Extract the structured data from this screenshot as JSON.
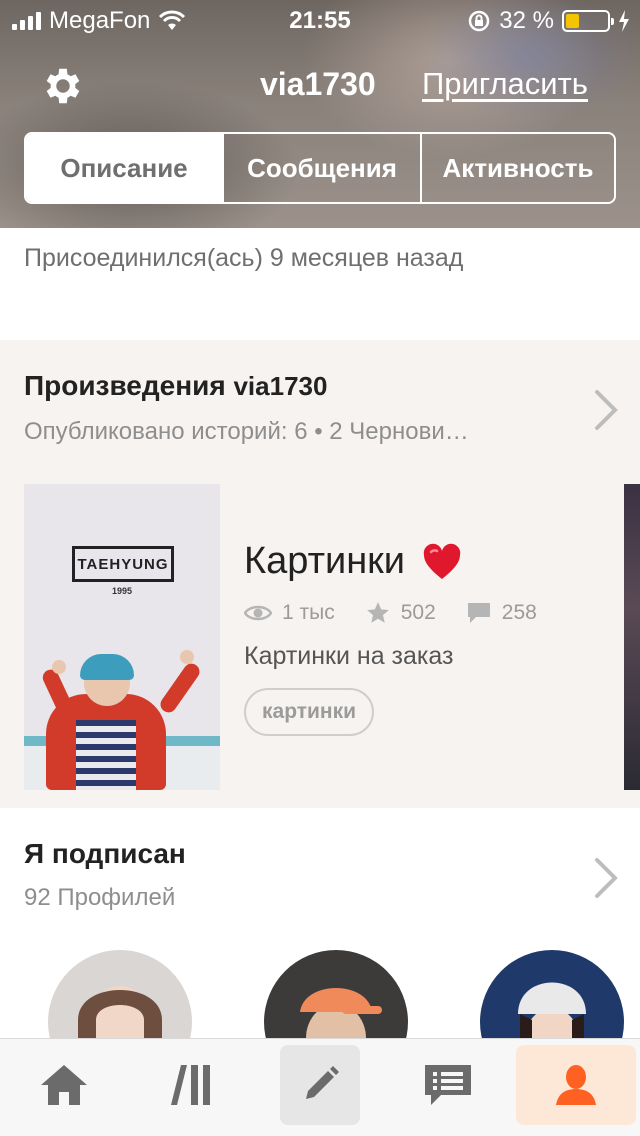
{
  "status_bar": {
    "carrier": "MegaFon",
    "time": "21:55",
    "battery": "32 %",
    "battery_level": 0.32
  },
  "header": {
    "username": "via1730",
    "invite_label": "Пригласить",
    "tabs": [
      {
        "label": "Описание",
        "active": true
      },
      {
        "label": "Сообщения",
        "active": false
      },
      {
        "label": "Активность",
        "active": false
      }
    ]
  },
  "profile": {
    "joined": "Присоединился(ась) 9 месяцев назад"
  },
  "works": {
    "title": "Произведения",
    "username": "via1730",
    "subtitle": "Опубликовано историй: 6 • 2 Чернови…",
    "story": {
      "cover_stamp": "TAEHYUNG",
      "cover_year": "1995",
      "title": "Картинки",
      "reads": "1 тыс",
      "votes": "502",
      "comments": "258",
      "description": "Картинки на заказ",
      "tag": "картинки"
    }
  },
  "following": {
    "title": "Я подписан",
    "count": "92 Профилей"
  },
  "tabbar": {
    "items": [
      "home-icon",
      "library-icon",
      "write-icon",
      "messages-icon",
      "profile-icon"
    ],
    "active": "profile-icon",
    "accent": "#ff6122"
  }
}
